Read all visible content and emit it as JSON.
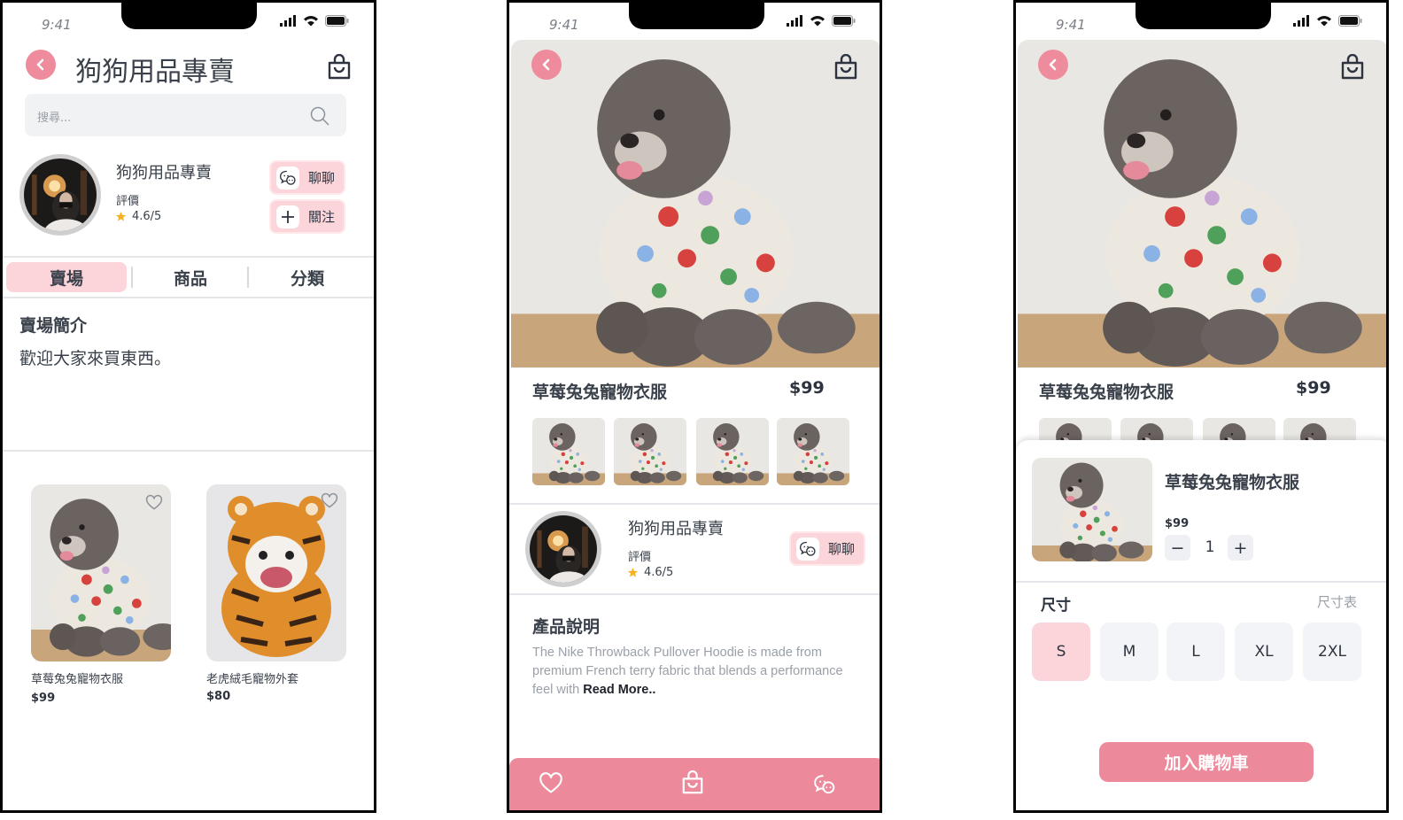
{
  "status_time": "9:41",
  "screen1": {
    "title": "狗狗用品專賣",
    "search_placeholder": "搜尋...",
    "shop_name": "狗狗用品專賣",
    "rating_label": "評價",
    "rating_value": "4.6/5",
    "chat_label": "聊聊",
    "follow_label": "關注",
    "tabs": [
      "賣場",
      "商品",
      "分類"
    ],
    "intro_title": "賣場簡介",
    "intro_text": "歡迎大家來買東西。",
    "products": [
      {
        "name": "草莓兔兔寵物衣服",
        "price": "$99"
      },
      {
        "name": "老虎絨毛寵物外套",
        "price": "$80"
      }
    ]
  },
  "screen2": {
    "product_name": "草莓兔兔寵物衣服",
    "price": "$99",
    "shop_name": "狗狗用品專賣",
    "rating_label": "評價",
    "rating_value": "4.6/5",
    "chat_label": "聊聊",
    "desc_title": "產品說明",
    "desc_text": "The Nike Throwback Pullover Hoodie is made from premium French terry fabric that blends a performance feel with ",
    "read_more": "Read More.."
  },
  "screen3": {
    "product_name": "草莓兔兔寵物衣服",
    "price": "$99",
    "sheet_name": "草莓兔兔寵物衣服",
    "sheet_price": "$99",
    "quantity": "1",
    "minus_label": "−",
    "plus_label": "+",
    "size_label": "尺寸",
    "size_chart_label": "尺寸表",
    "sizes": [
      "S",
      "M",
      "L",
      "XL",
      "2XL"
    ],
    "selected_size": "S",
    "add_to_cart": "加入購物車"
  },
  "colors": {
    "accent_pink": "#ee8b9c",
    "light_pink": "#fbd5d9",
    "bottom_bar": "#ec8a9b",
    "star": "#f5b324"
  }
}
